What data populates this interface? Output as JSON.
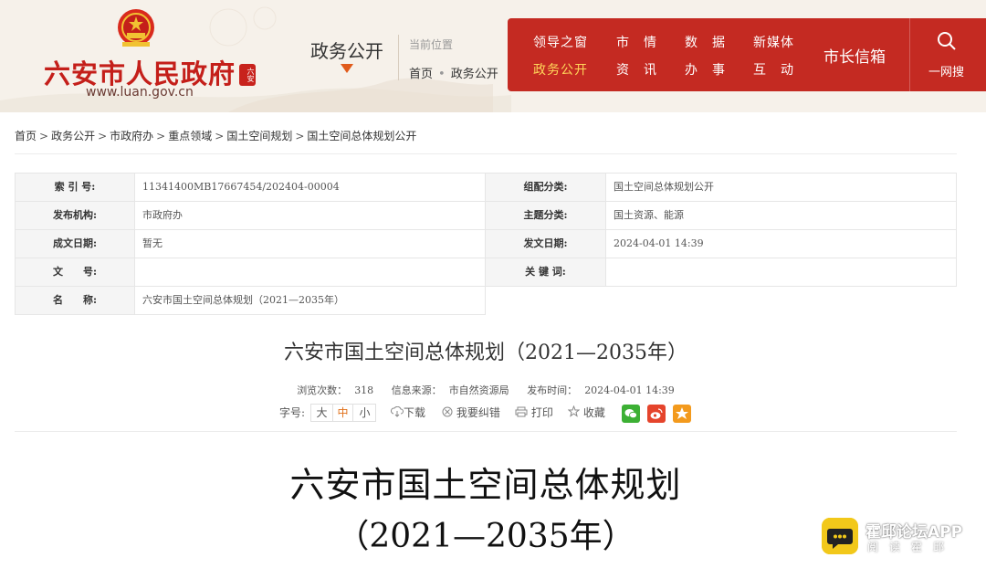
{
  "header": {
    "site_name": "六安市人民政府",
    "site_url": "www.luan.gov.cn",
    "section_title": "政务公开",
    "location_label": "当前位置",
    "location_path": [
      "首页",
      "政务公开"
    ]
  },
  "nav": {
    "items": [
      {
        "label": "领导之窗",
        "active": false
      },
      {
        "label": "市　情",
        "active": false
      },
      {
        "label": "数　据",
        "active": false
      },
      {
        "label": "新媒体",
        "active": false
      },
      {
        "label": "政务公开",
        "active": true
      },
      {
        "label": "资　讯",
        "active": false
      },
      {
        "label": "办　事",
        "active": false
      },
      {
        "label": "互　动",
        "active": false
      }
    ],
    "mayor_mailbox": "市长信箱",
    "search_label": "一网搜",
    "bg_color": "#c42a22",
    "active_color": "#ffd65a"
  },
  "breadcrumb": [
    "首页",
    "政务公开",
    "市政府办",
    "重点领域",
    "国土空间规划",
    "国土空间总体规划公开"
  ],
  "info": {
    "index_no_label": "索 引 号:",
    "index_no": "11341400MB17667454/202404-00004",
    "category_label": "组配分类:",
    "category": "国土空间总体规划公开",
    "publisher_label": "发布机构:",
    "publisher": "市政府办",
    "subject_label": "主题分类:",
    "subject": "国土资源、能源",
    "date_made_label": "成文日期:",
    "date_made": "暂无",
    "date_issued_label": "发文日期:",
    "date_issued": "2024-04-01 14:39",
    "doc_no_label": "文　　号:",
    "doc_no": "",
    "keywords_label": "关 键 词:",
    "keywords": "",
    "name_label": "名　　称:",
    "name": "六安市国土空间总体规划（2021—2035年）"
  },
  "article": {
    "title": "六安市国土空间总体规划（2021—2035年）",
    "views_label": "浏览次数：",
    "views": "318",
    "source_label": "信息来源：",
    "source": "市自然资源局",
    "publish_label": "发布时间：",
    "publish_time": "2024-04-01 14:39",
    "font_label": "字号:",
    "font_sizes": [
      "大",
      "中",
      "小"
    ],
    "download": "下载",
    "report_error": "我要纠错",
    "print": "打印",
    "favorite": "收藏",
    "body_title_line1": "六安市国土空间总体规划",
    "body_title_line2": "（2021—2035年）"
  },
  "watermark": {
    "name": "霍邱论坛APP",
    "subtitle": "阅读霍邱"
  }
}
